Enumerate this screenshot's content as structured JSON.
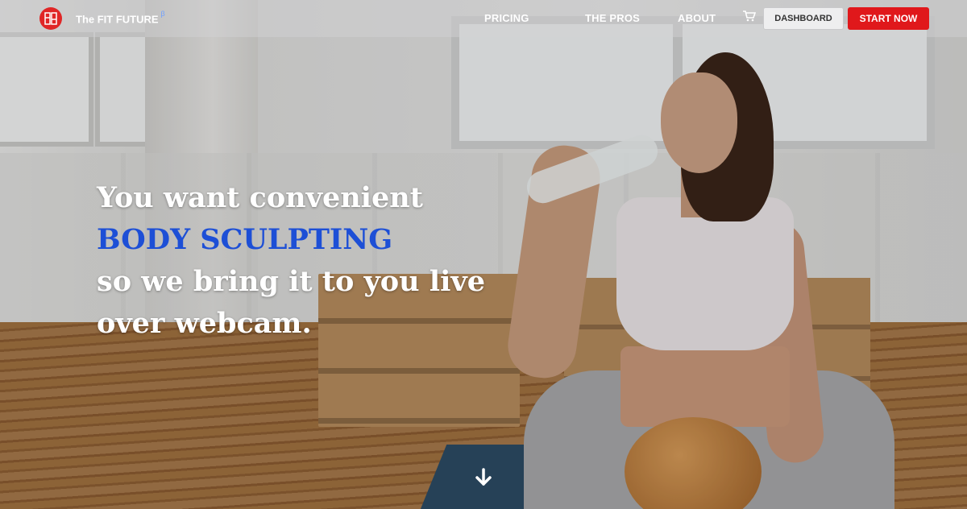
{
  "brand": {
    "name": "The FIT FUTURE",
    "superscript": "β",
    "logo_icon": "fit-future-logo-icon"
  },
  "nav": {
    "links": [
      {
        "label": "PRICING"
      },
      {
        "label": "THE PROS"
      },
      {
        "label": "ABOUT"
      }
    ],
    "cart_icon": "cart-icon",
    "dashboard_label": "DASHBOARD",
    "start_label": "START NOW"
  },
  "hero": {
    "line1": "You want convenient",
    "line2": "BODY SCULPTING",
    "line3": "so we bring it to you live",
    "line4": "over webcam.",
    "scroll_icon": "arrow-down-icon"
  },
  "colors": {
    "accent_red": "#e0181b",
    "headline_blue": "#1d4fd6",
    "beta_blue": "#6fa0ff"
  }
}
